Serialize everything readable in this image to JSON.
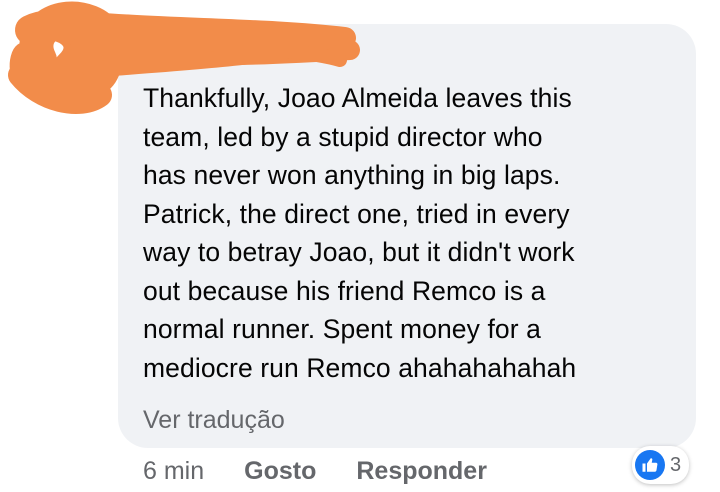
{
  "comment": {
    "author": "",
    "lines": [
      "Thankfully, Joao Almeida leaves this",
      "team, led by a stupid director who",
      "has never won anything in big laps.",
      "Patrick, the direct one, tried in every",
      "way to betray Joao, but it didn't work",
      "out because his friend Remco is a",
      "normal runner. Spent money for a",
      "mediocre run Remco ahahahahahah"
    ],
    "translate_label": "Ver tradução"
  },
  "actions": {
    "time": "6 min",
    "like_label": "Gosto",
    "reply_label": "Responder"
  },
  "reactions": {
    "icon": "thumbs-up-icon",
    "count": "3"
  },
  "colors": {
    "bubble": "#f0f2f5",
    "text": "#050505",
    "secondary_text": "#65676b",
    "like_blue": "#1877f2",
    "redaction": "#f28c4a"
  }
}
